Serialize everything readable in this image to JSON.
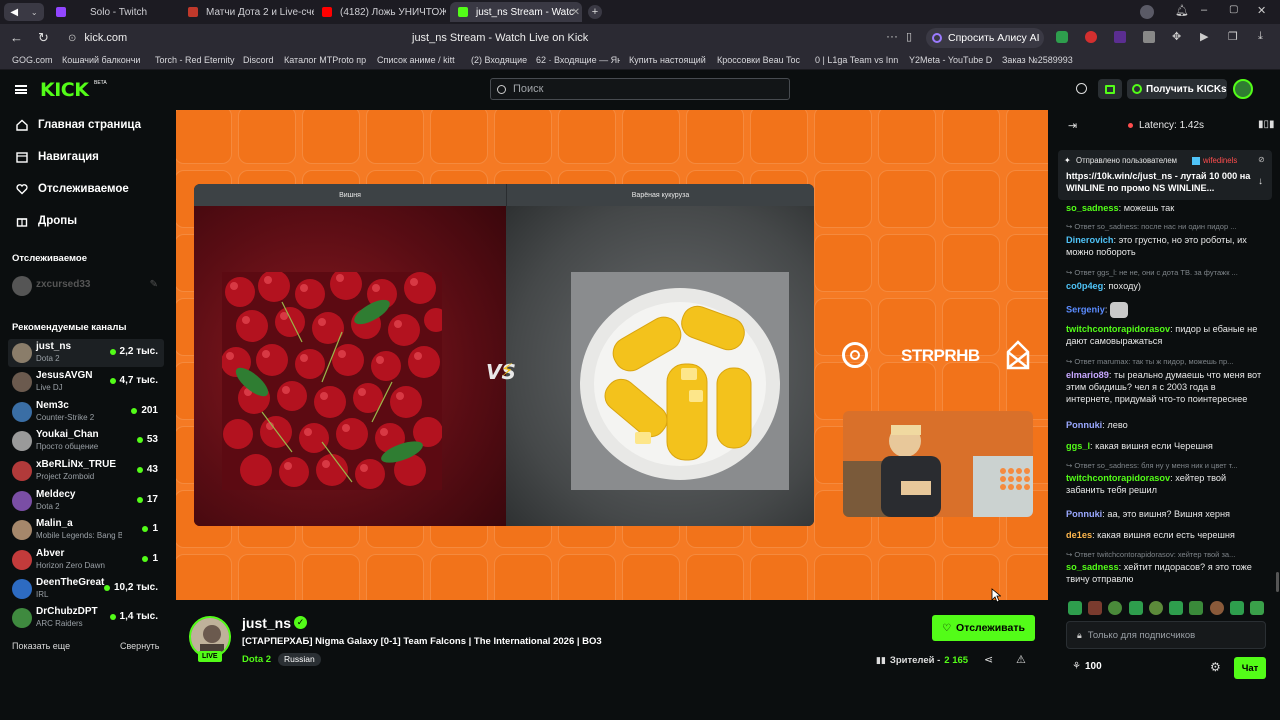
{
  "browser": {
    "tabs": [
      {
        "label": "Solo - Twitch",
        "color": "#9146ff"
      },
      {
        "label": "Матчи Дота 2 и Live-сче",
        "color": "#c0392b"
      },
      {
        "label": "(4182) Ложь УНИЧТОЖИ",
        "color": "#ff0000"
      },
      {
        "label": "just_ns Stream - Watc",
        "color": "#53fc18"
      }
    ],
    "address": "kick.com",
    "page_title": "just_ns Stream - Watch Live on Kick",
    "alice_label": "Спросить Алису AI",
    "bookmarks": [
      "GOG.com",
      "Кошачий балкончи",
      "Torch - Red Eternity",
      "Discord",
      "Каталог MTProto пр",
      "Список аниме / kitt",
      "(2) Входящие",
      "62 · Входящие — Ян",
      "Купить настоящий",
      "Кроссовки Beau Toc",
      "0 | L1ga Team vs Inn",
      "Y2Meta - YouTube D",
      "Заказ №2589993"
    ]
  },
  "header": {
    "logo": "KICK",
    "logo_beta": "BETA",
    "search_placeholder": "Поиск",
    "get_kicks_label": "Получить KICKs"
  },
  "sidebar": {
    "nav": [
      "Главная страница",
      "Навигация",
      "Отслеживаемое",
      "Дропы"
    ],
    "followed_heading": "Отслеживаемое",
    "followed": [
      {
        "name": "zxcursed33"
      }
    ],
    "recommended_heading": "Рекомендуемые каналы",
    "channels": [
      {
        "name": "just_ns",
        "game": "Dota 2",
        "viewers": "2,2 тыс.",
        "color": "#8a7d6a"
      },
      {
        "name": "JesusAVGN",
        "game": "Live DJ",
        "viewers": "4,7 тыс.",
        "color": "#6b5a4e"
      },
      {
        "name": "Nem3c",
        "game": "Counter-Strike 2",
        "viewers": "201",
        "color": "#3a6ea5"
      },
      {
        "name": "Youkai_Chan",
        "game": "Просто общение",
        "viewers": "53",
        "color": "#9a9a9a"
      },
      {
        "name": "xBeRLiNx_TRUE",
        "game": "Project Zomboid",
        "viewers": "43",
        "color": "#b23a3a"
      },
      {
        "name": "Meldecy",
        "game": "Dota 2",
        "viewers": "17",
        "color": "#7a4ea5"
      },
      {
        "name": "Malin_a",
        "game": "Mobile Legends: Bang Ba...",
        "viewers": "1",
        "color": "#a5876b"
      },
      {
        "name": "Abver",
        "game": "Horizon Zero Dawn",
        "viewers": "1",
        "color": "#c23b3b"
      },
      {
        "name": "DeenTheGreat",
        "game": "IRL",
        "viewers": "10,2 тыс.",
        "color": "#2d6bc2"
      },
      {
        "name": "DrChubzDPT",
        "game": "ARC Raiders",
        "viewers": "1,4 тыс.",
        "color": "#3f8a3f"
      }
    ],
    "show_more": "Показать еще",
    "collapse": "Свернуть"
  },
  "video": {
    "left_label": "Вишня",
    "right_label": "Варёная кукуруза",
    "vs_text": "VS",
    "brand_text": "STRPRHB"
  },
  "stream": {
    "streamer": "just_ns",
    "live_badge": "LIVE",
    "title": "[СТАРПЕРХАБ] Nigma Galaxy [0-1] Team Falcons | The International 2026 | BO3",
    "category": "Dota 2",
    "language": "Russian",
    "follow_label": "Отслеживать",
    "viewers_label": "Зрителей -",
    "viewers_count": "2 165"
  },
  "chat": {
    "latency": "Latency: 1.42s",
    "pinned_by": "Отправлено пользователем",
    "pinned_user": "wifedinels",
    "pinned_text": "https://10k.win/c/just_ns - лутай 10 000 на WINLINE по промо NS WINLINE...",
    "messages": [
      {
        "reply": "",
        "user": "so_sadness",
        "color": "#53fc18",
        "text": "можешь так"
      },
      {
        "reply": "Ответ so_sadness: после нас ни один пидор ...",
        "user": "Dinerovich",
        "color": "#4fc3f7",
        "text": "это грустно, но это роботы, их можно побороть"
      },
      {
        "reply": "Ответ ggs_l: не не, они с дота TB. за футажк ...",
        "user": "co0p4eg",
        "color": "#4fc3f7",
        "text": "поxоду)"
      },
      {
        "reply": "",
        "user": "Sergeniy",
        "color": "#5b8cff",
        "text": ""
      },
      {
        "reply": "",
        "user": "twitchcontorapidorasov",
        "color": "#53fc18",
        "text": "пидор ы ебаные не дают самовыражаться"
      },
      {
        "reply": "Ответ marumax: так ты ж пидор, можешь пр...",
        "user": "elmario89",
        "color": "#c7a8ff",
        "text": "ты реально думаешь что меня вот этим обидишь? чел я с 2003 года в интернете, придумай что-то поинтереснее"
      },
      {
        "reply": "",
        "user": "Ponnuki",
        "color": "#9aa8ff",
        "text": "лево"
      },
      {
        "reply": "",
        "user": "ggs_l",
        "color": "#53fc18",
        "text": "какая вишня если Черешня"
      },
      {
        "reply": "Ответ so_sadness: бля ну у меня ник и цвет т...",
        "user": "twitchcontorapidorasov",
        "color": "#53fc18",
        "text": "хейтер твой забанить тебя решил"
      },
      {
        "reply": "",
        "user": "Ponnuki",
        "color": "#9aa8ff",
        "text": "аа, это вишня? Вишня херня"
      },
      {
        "reply": "",
        "user": "de1es",
        "color": "#ffb74d",
        "text": "какая вишня если есть черешня"
      },
      {
        "reply": "Ответ twitchcontorapidorasov: хейтер твой за...",
        "user": "so_sadness",
        "color": "#53fc18",
        "text": "хейтит пидорасов? я это тоже твичу отправлю"
      }
    ],
    "input_placeholder": "Только для подписчиков",
    "points": "100",
    "send_label": "Чат"
  },
  "colors": {
    "kick_green": "#53fc18",
    "video_orange": "#f57a24"
  }
}
